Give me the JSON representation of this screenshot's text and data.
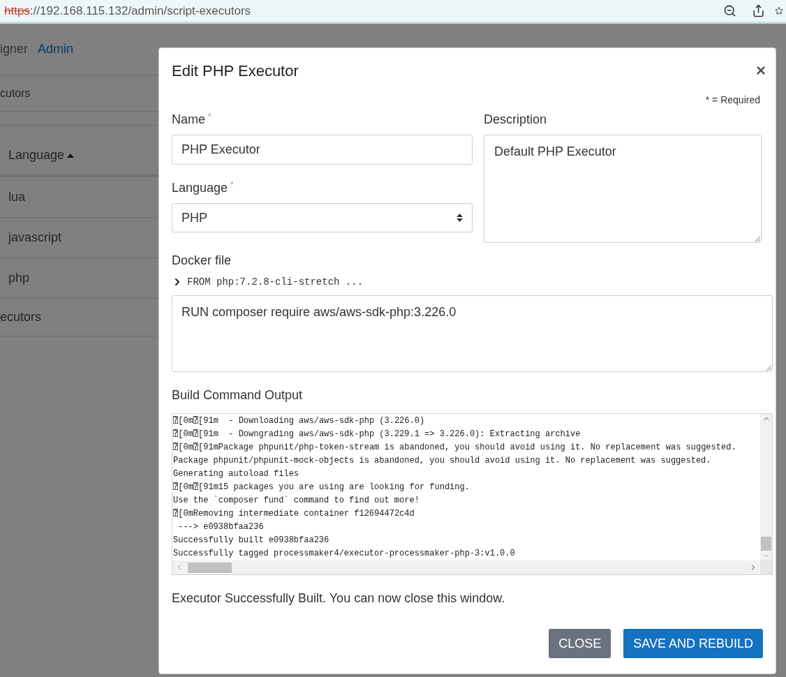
{
  "browser": {
    "url_scheme": "https",
    "url_rest": "://192.168.115.132/admin/script-executors"
  },
  "background_page": {
    "nav": [
      {
        "label": "igner",
        "selected": false
      },
      {
        "label": "Admin",
        "selected": true
      }
    ],
    "breadcrumb": "cutors",
    "table": {
      "column": "Language",
      "rows": [
        "lua",
        "javascript",
        "php"
      ]
    },
    "footer": "ecutors"
  },
  "modal": {
    "title": "Edit PHP Executor",
    "close": "×",
    "required_note": "* = Required",
    "name": {
      "label": "Name",
      "required_mark": "*",
      "value": "PHP Executor"
    },
    "language": {
      "label": "Language",
      "required_mark": "*",
      "value": "PHP"
    },
    "description": {
      "label": "Description",
      "value": "Default PHP Executor"
    },
    "docker": {
      "label": "Docker file",
      "summary": "FROM php:7.2.8-cli-stretch ...",
      "expanded": false,
      "value": "RUN composer require aws/aws-sdk-php:3.226.0"
    },
    "output": {
      "label": "Build Command Output",
      "lines": [
        "⍰[0m⍰[91m  - Downloading aws/aws-sdk-php (3.226.0)",
        "⍰[0m⍰[91m  - Downgrading aws/aws-sdk-php (3.229.1 => 3.226.0): Extracting archive",
        "⍰[0m⍰[91mPackage phpunit/php-token-stream is abandoned, you should avoid using it. No replacement was suggested.",
        "Package phpunit/phpunit-mock-objects is abandoned, you should avoid using it. No replacement was suggested.",
        "Generating autoload files",
        "⍰[0m⍰[91m15 packages you are using are looking for funding.",
        "Use the `composer fund` command to find out more!",
        "⍰[0mRemoving intermediate container f12694472c4d",
        " ---> e0938bfaa236",
        "Successfully built e0938bfaa236",
        "Successfully tagged processmaker4/executor-processmaker-php-3:v1.0.0"
      ]
    },
    "status": "Executor Successfully Built. You can now close this window.",
    "buttons": [
      {
        "label": "CLOSE",
        "kind": "secondary"
      },
      {
        "label": "SAVE AND REBUILD",
        "kind": "primary"
      }
    ]
  }
}
